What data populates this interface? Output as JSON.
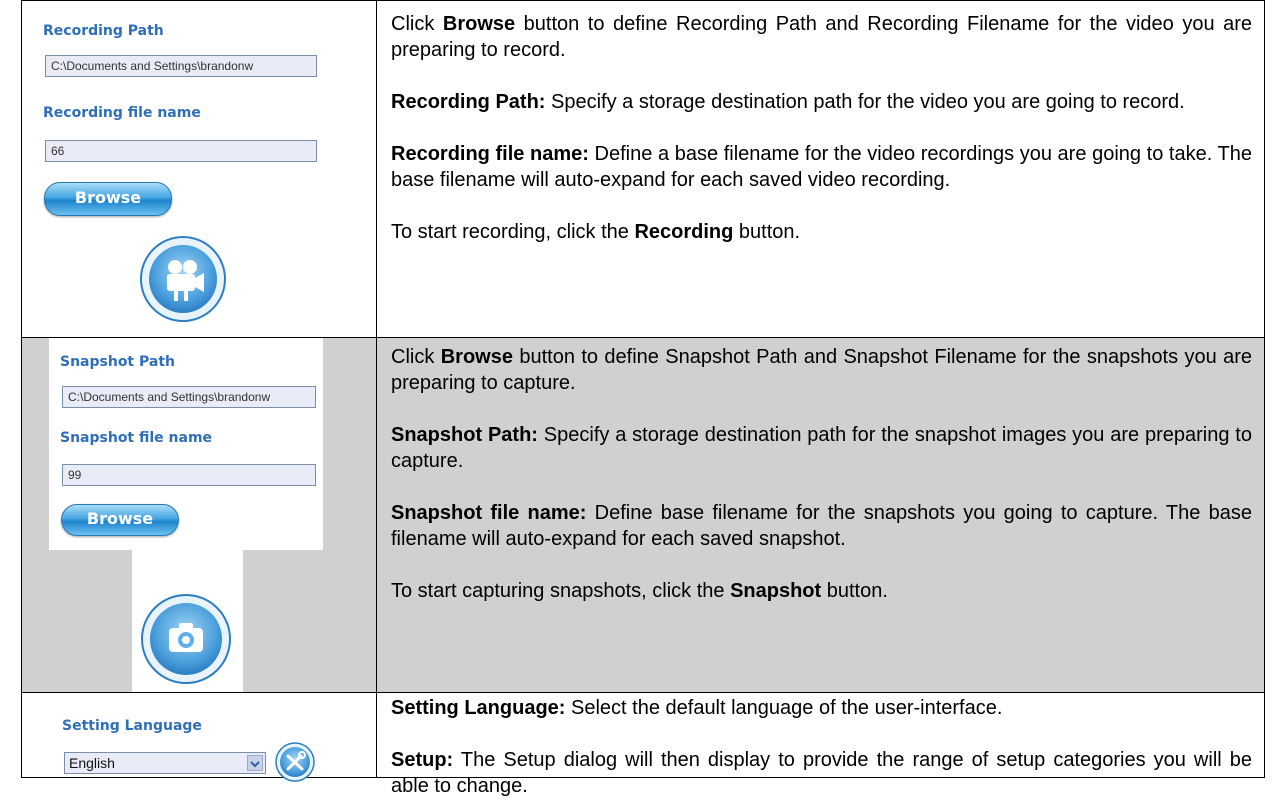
{
  "row1": {
    "recording_path_label": "Recording Path",
    "recording_path_value": "C:\\Documents and Settings\\brandonw",
    "recording_file_label": "Recording file name",
    "recording_file_value": "66",
    "browse_label": "Browse",
    "record_icon": "video-camera-icon",
    "text": {
      "p1_pre": "Click ",
      "p1_bold": "Browse",
      "p1_post": " button to define Recording Path and Recording Filename for the video you are preparing to record.",
      "p2_bold": "Recording Path:",
      "p2_post": " Specify a storage destination path for the video you are going to record.",
      "p3_bold": "Recording file name:",
      "p3_post": " Define a base filename for the video recordings you are going to take. The base filename will auto-expand for each saved video recording.",
      "p4_pre": "To start recording, click the ",
      "p4_bold": "Recording",
      "p4_post": " button."
    }
  },
  "row2": {
    "snapshot_path_label": "Snapshot Path",
    "snapshot_path_value": "C:\\Documents and Settings\\brandonw",
    "snapshot_file_label": "Snapshot file name",
    "snapshot_file_value": "99",
    "browse_label": "Browse",
    "snapshot_icon": "camera-icon",
    "text": {
      "p1_pre": "Click ",
      "p1_bold": "Browse",
      "p1_post": " button to define Snapshot Path and Snapshot Filename for the snapshots you are preparing to capture.",
      "p2_bold": "Snapshot Path:",
      "p2_post": " Specify a storage destination path for the snapshot images you are preparing to capture.",
      "p3_bold": "Snapshot file name:",
      "p3_post": " Define base filename for the snapshots you going to capture. The base filename will auto-expand for each saved snapshot.",
      "p4_pre": "To start capturing snapshots, click the ",
      "p4_bold": "Snapshot",
      "p4_post": " button."
    }
  },
  "row3": {
    "language_label": "Setting Language",
    "language_value": "English",
    "setup_icon": "tools-icon",
    "text": {
      "p1_bold": "Setting Language:",
      "p1_post": " Select the default language of the user-interface.",
      "p2_bold": "Setup:",
      "p2_post": " The Setup dialog will then display to provide the range of setup categories you will be able to change."
    }
  },
  "colors": {
    "label_blue": "#2f6fb8",
    "row2_background": "#d0d0d0",
    "button_blue": "#1d84cc"
  }
}
